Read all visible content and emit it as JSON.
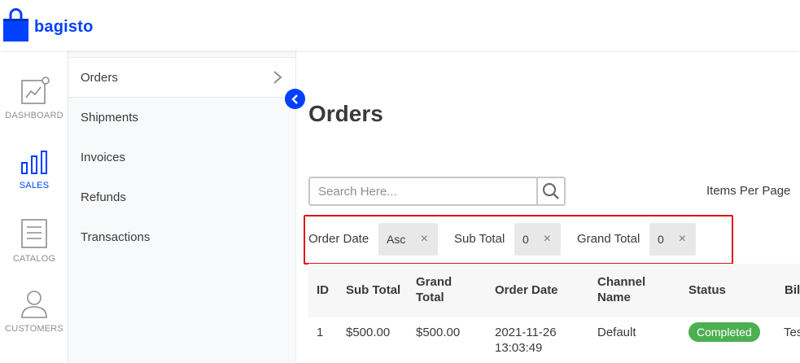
{
  "app": {
    "name": "bagisto",
    "brand_color": "#0041ff"
  },
  "rail": [
    {
      "label": "DASHBOARD",
      "icon": "dashboard-icon"
    },
    {
      "label": "SALES",
      "icon": "sales-chart-icon",
      "active": true
    },
    {
      "label": "CATALOG",
      "icon": "catalog-icon"
    },
    {
      "label": "CUSTOMERS",
      "icon": "customers-icon"
    }
  ],
  "subnav": {
    "items": [
      {
        "label": "Orders",
        "active": true
      },
      {
        "label": "Shipments"
      },
      {
        "label": "Invoices"
      },
      {
        "label": "Refunds"
      },
      {
        "label": "Transactions"
      }
    ]
  },
  "main": {
    "title": "Orders",
    "search": {
      "placeholder": "Search Here...",
      "value": ""
    },
    "items_per_page_label": "Items Per Page"
  },
  "filters": [
    {
      "label": "Order Date",
      "value": "Asc"
    },
    {
      "label": "Sub Total",
      "value": "0"
    },
    {
      "label": "Grand Total",
      "value": "0"
    }
  ],
  "filter_remove_glyph": "×",
  "filter_highlight_color": "#e0131a",
  "table": {
    "headers": {
      "id": "ID",
      "sub_total": "Sub Total",
      "grand_total": [
        "Grand",
        "Total"
      ],
      "order_date": "Order Date",
      "channel": [
        "Channel",
        "Name"
      ],
      "status": "Status",
      "billed_to": "Bill"
    },
    "rows": [
      {
        "id": "1",
        "sub_total": "$500.00",
        "grand_total": "$500.00",
        "order_date": [
          "2021-11-26",
          "13:03:49"
        ],
        "channel": "Default",
        "status": "Completed",
        "billed_to": "Tes"
      }
    ]
  },
  "status_color": "#4caf50"
}
